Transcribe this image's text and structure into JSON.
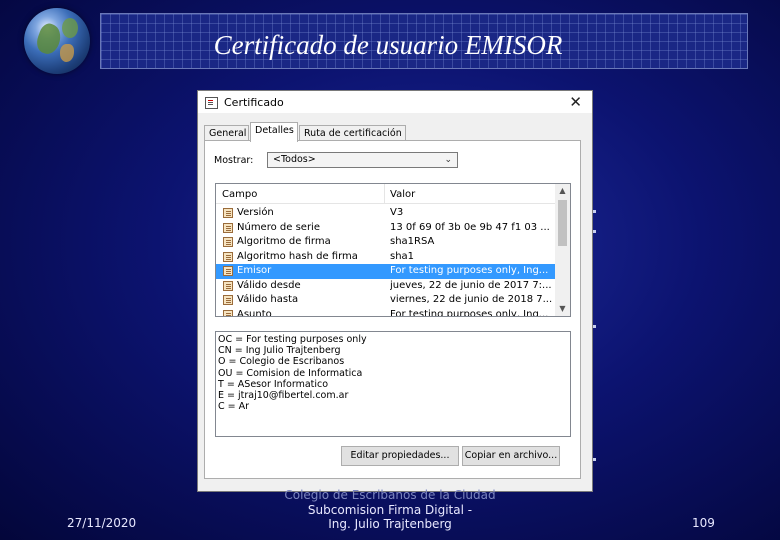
{
  "slide": {
    "title": "Certificado de usuario EMISOR",
    "footer": {
      "date": "27/11/2020",
      "center_lines": [
        "Colegio de Escribanos de la Ciudad",
        "Subcomision Firma Digital -",
        "Ing. Julio Trajtenberg"
      ],
      "page": "109"
    }
  },
  "dialog": {
    "title": "Certificado",
    "close_glyph": "✕",
    "tabs": [
      "General",
      "Detalles",
      "Ruta de certificación"
    ],
    "active_tab": "Detalles",
    "show_label": "Mostrar:",
    "show_value": "<Todos>",
    "columns": {
      "field": "Campo",
      "value": "Valor"
    },
    "rows": [
      {
        "field": "Versión",
        "value": "V3"
      },
      {
        "field": "Número de serie",
        "value": "13 0f 69 0f 3b 0e 9b 47 f1 03 ..."
      },
      {
        "field": "Algoritmo de firma",
        "value": "sha1RSA"
      },
      {
        "field": "Algoritmo hash de firma",
        "value": "sha1"
      },
      {
        "field": "Emisor",
        "value": "For testing purposes only, Ing...",
        "selected": true
      },
      {
        "field": "Válido desde",
        "value": "jueves, 22 de junio de 2017 7:..."
      },
      {
        "field": "Válido hasta",
        "value": "viernes, 22 de junio de 2018 7..."
      },
      {
        "field": "Asunto",
        "value": "For testing purposes only, Ing..."
      }
    ],
    "detail_lines": [
      "OC = For testing purposes only",
      "CN = Ing Julio Trajtenberg",
      "O = Colegio de Escribanos",
      "OU = Comision de Informatica",
      "T = ASesor Informatico",
      "E = jtraj10@fibertel.com.ar",
      "C = Ar"
    ],
    "buttons": {
      "edit": "Editar propiedades...",
      "copy": "Copiar en archivo..."
    }
  },
  "colors": {
    "selection": "#3399ff",
    "background": "#0c1370"
  }
}
